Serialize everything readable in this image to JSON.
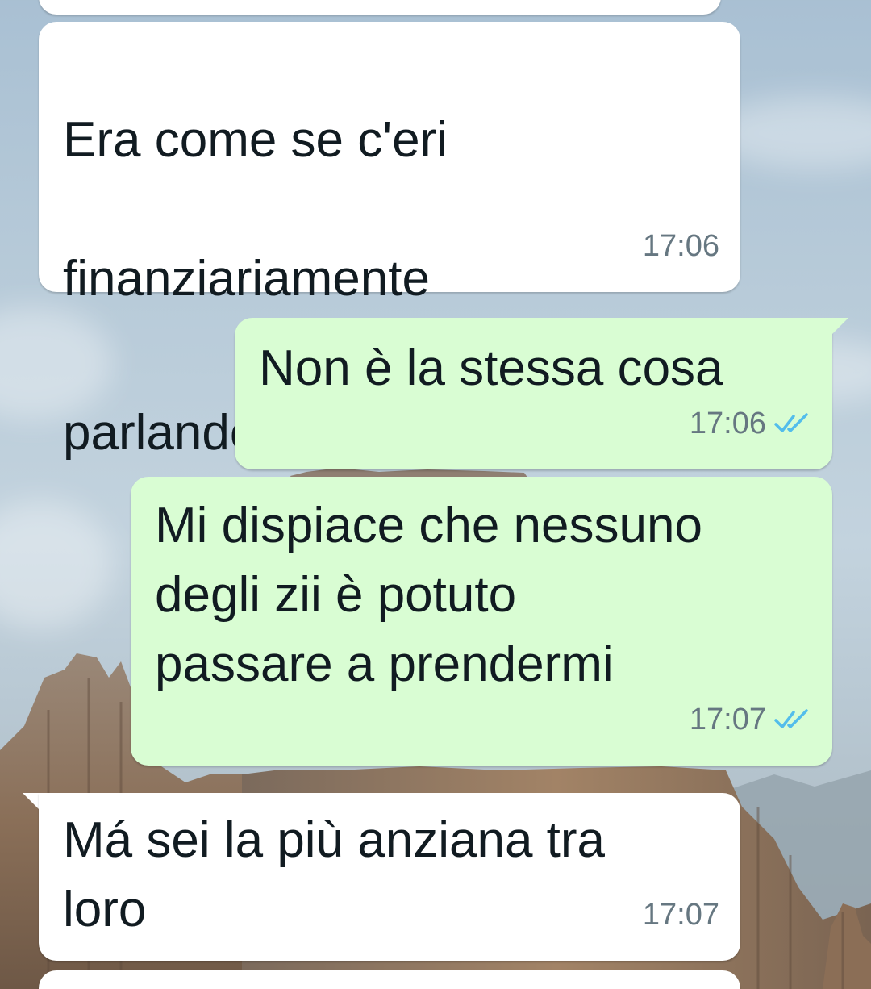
{
  "messages": [
    {
      "direction": "incoming",
      "text_lines": [
        "Era come se c'eri",
        "finanziariamente",
        "parlando"
      ],
      "emoji": "face-with-tears-of-joy-icon",
      "time": "17:06"
    },
    {
      "direction": "outgoing",
      "text": "Non è la stessa cosa",
      "time": "17:06",
      "status": "read"
    },
    {
      "direction": "outgoing",
      "text": "Mi dispiace che nessuno\ndegli zii è potuto\npassare a prendermi",
      "time": "17:07",
      "status": "read"
    },
    {
      "direction": "incoming",
      "text": "Má sei la più anziana tra\nloro",
      "time": "17:07"
    }
  ],
  "colors": {
    "incoming_bubble": "#ffffff",
    "outgoing_bubble": "#d9fdd3",
    "text": "#111b21",
    "meta_text": "#667781",
    "read_ticks": "#53bdeb"
  }
}
